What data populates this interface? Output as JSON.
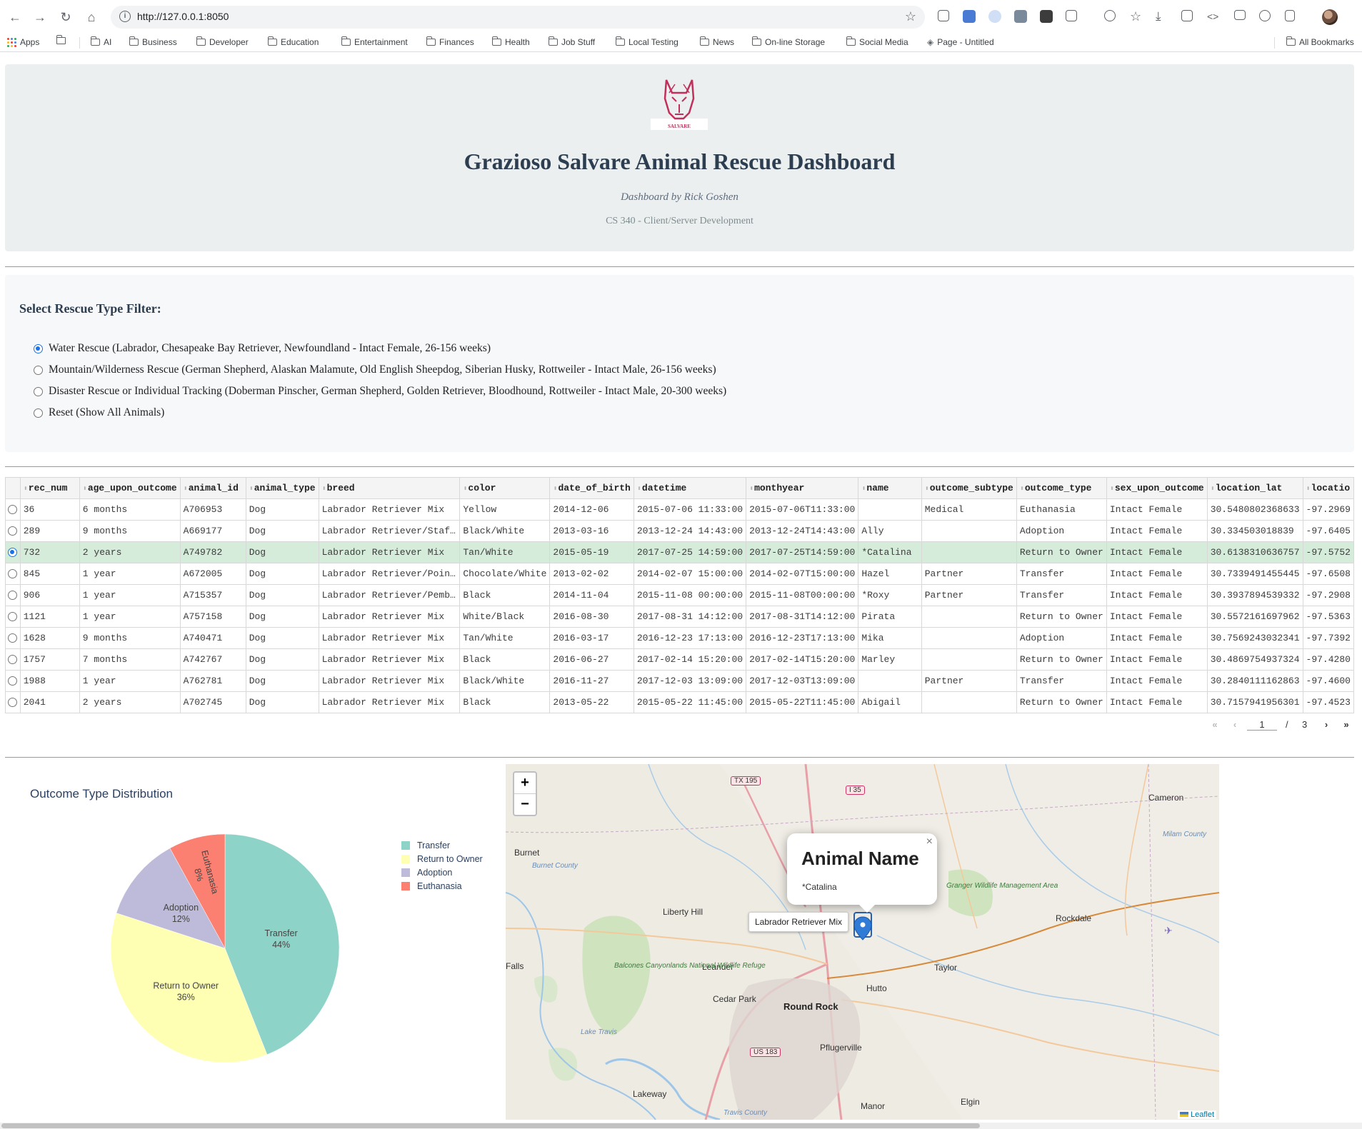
{
  "browser": {
    "url": "http://127.0.0.1:8050",
    "bookmarks": [
      "Apps",
      "AI",
      "Business",
      "Developer",
      "Education",
      "Entertainment",
      "Finances",
      "Health",
      "Job Stuff",
      "Local Testing",
      "News",
      "On-line Storage",
      "Social Media",
      "Page - Untitled"
    ],
    "all_bookmarks": "All Bookmarks"
  },
  "header": {
    "logo_text": "SALVARE",
    "title": "Grazioso Salvare Animal Rescue Dashboard",
    "byline": "Dashboard by Rick Goshen",
    "course": "CS 340 - Client/Server Development"
  },
  "filter": {
    "title": "Select Rescue Type Filter:",
    "options": [
      {
        "label": "Water Rescue (Labrador, Chesapeake Bay Retriever, Newfoundland - Intact Female, 26-156 weeks)",
        "selected": true
      },
      {
        "label": "Mountain/Wilderness Rescue (German Shepherd, Alaskan Malamute, Old English Sheepdog, Siberian Husky, Rottweiler - Intact Male, 26-156 weeks)",
        "selected": false
      },
      {
        "label": "Disaster Rescue or Individual Tracking (Doberman Pinscher, German Shepherd, Golden Retriever, Bloodhound, Rottweiler - Intact Male, 20-300 weeks)",
        "selected": false
      },
      {
        "label": "Reset (Show All Animals)",
        "selected": false
      }
    ]
  },
  "table": {
    "columns": [
      "rec_num",
      "age_upon_outcome",
      "animal_id",
      "animal_type",
      "breed",
      "color",
      "date_of_birth",
      "datetime",
      "monthyear",
      "name",
      "outcome_subtype",
      "outcome_type",
      "sex_upon_outcome",
      "location_lat",
      "locatio"
    ],
    "rows": [
      [
        "36",
        "6 months",
        "A706953",
        "Dog",
        "Labrador Retriever Mix",
        "Yellow",
        "2014-12-06",
        "2015-07-06 11:33:00",
        "2015-07-06T11:33:00",
        "",
        "Medical",
        "Euthanasia",
        "Intact Female",
        "30.5480802368633",
        "-97.2969"
      ],
      [
        "289",
        "9 months",
        "A669177",
        "Dog",
        "Labrador Retriever/Staf…",
        "Black/White",
        "2013-03-16",
        "2013-12-24 14:43:00",
        "2013-12-24T14:43:00",
        "Ally",
        "",
        "Adoption",
        "Intact Female",
        "30.334503018839",
        "-97.6405"
      ],
      [
        "732",
        "2 years",
        "A749782",
        "Dog",
        "Labrador Retriever Mix",
        "Tan/White",
        "2015-05-19",
        "2017-07-25 14:59:00",
        "2017-07-25T14:59:00",
        "*Catalina",
        "",
        "Return to Owner",
        "Intact Female",
        "30.6138310636757",
        "-97.5752"
      ],
      [
        "845",
        "1 year",
        "A672005",
        "Dog",
        "Labrador Retriever/Poin…",
        "Chocolate/White",
        "2013-02-02",
        "2014-02-07 15:00:00",
        "2014-02-07T15:00:00",
        "Hazel",
        "Partner",
        "Transfer",
        "Intact Female",
        "30.7339491455445",
        "-97.6508"
      ],
      [
        "906",
        "1 year",
        "A715357",
        "Dog",
        "Labrador Retriever/Pemb…",
        "Black",
        "2014-11-04",
        "2015-11-08 00:00:00",
        "2015-11-08T00:00:00",
        "*Roxy",
        "Partner",
        "Transfer",
        "Intact Female",
        "30.3937894539332",
        "-97.2908"
      ],
      [
        "1121",
        "1 year",
        "A757158",
        "Dog",
        "Labrador Retriever Mix",
        "White/Black",
        "2016-08-30",
        "2017-08-31 14:12:00",
        "2017-08-31T14:12:00",
        "Pirata",
        "",
        "Return to Owner",
        "Intact Female",
        "30.5572161697962",
        "-97.5363"
      ],
      [
        "1628",
        "9 months",
        "A740471",
        "Dog",
        "Labrador Retriever Mix",
        "Tan/White",
        "2016-03-17",
        "2016-12-23 17:13:00",
        "2016-12-23T17:13:00",
        "Mika",
        "",
        "Adoption",
        "Intact Female",
        "30.7569243032341",
        "-97.7392"
      ],
      [
        "1757",
        "7 months",
        "A742767",
        "Dog",
        "Labrador Retriever Mix",
        "Black",
        "2016-06-27",
        "2017-02-14 15:20:00",
        "2017-02-14T15:20:00",
        "Marley",
        "",
        "Return to Owner",
        "Intact Female",
        "30.4869754937324",
        "-97.4280"
      ],
      [
        "1988",
        "1 year",
        "A762781",
        "Dog",
        "Labrador Retriever Mix",
        "Black/White",
        "2016-11-27",
        "2017-12-03 13:09:00",
        "2017-12-03T13:09:00",
        "",
        "Partner",
        "Transfer",
        "Intact Female",
        "30.2840111162863",
        "-97.4600"
      ],
      [
        "2041",
        "2 years",
        "A702745",
        "Dog",
        "Labrador Retriever Mix",
        "Black",
        "2013-05-22",
        "2015-05-22 11:45:00",
        "2015-05-22T11:45:00",
        "Abigail",
        "",
        "Return to Owner",
        "Intact Female",
        "30.7157941956301",
        "-97.4523"
      ]
    ],
    "selected_row": 2,
    "pager": {
      "current": "1",
      "separator": "/",
      "total": "3"
    }
  },
  "chart_data": {
    "type": "pie",
    "title": "Outcome Type Distribution",
    "labels": [
      "Transfer",
      "Return to Owner",
      "Adoption",
      "Euthanasia"
    ],
    "values": [
      44,
      36,
      12,
      8
    ],
    "display_percent": [
      "44%",
      "36%",
      "12%",
      "8%"
    ],
    "colors": [
      "#8dd3c7",
      "#ffffb3",
      "#bebada",
      "#fb8072"
    ],
    "legend_position": "right"
  },
  "map": {
    "popup_title": "Animal Name",
    "popup_name": "*Catalina",
    "tooltip": "Labrador Retriever Mix",
    "zoom_in": "+",
    "zoom_out": "−",
    "attribution": "Leaflet",
    "labels": {
      "round_rock": "Round Rock",
      "cedar_park": "Cedar Park",
      "leander": "Leander",
      "liberty_hill": "Liberty Hill",
      "hutto": "Hutto",
      "taylor": "Taylor",
      "pflugerville": "Pflugerville",
      "rockdale": "Rockdale",
      "cameron": "Cameron",
      "burnet": "Burnet",
      "lakeway": "Lakeway",
      "manor": "Manor",
      "elgin": "Elgin",
      "falls": "Falls",
      "milam": "Milam County",
      "burnet_county": "Burnet County",
      "travis_county": "Travis County",
      "balcones": "Balcones Canyonlands National Wildlife Refuge",
      "granger": "Granger Wildlife Management Area",
      "lake_travis": "Lake Travis",
      "tx195": "TX 195",
      "i35": "I 35",
      "us183": "US 183"
    }
  }
}
